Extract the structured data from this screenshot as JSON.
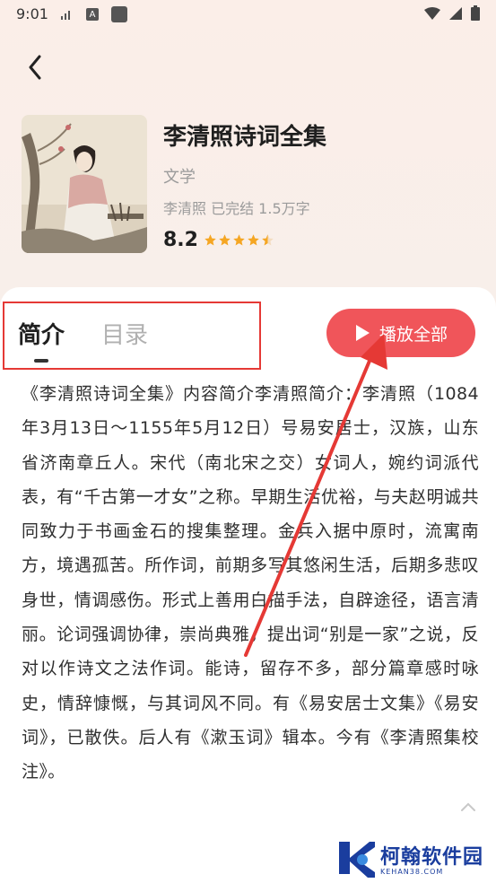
{
  "status_bar": {
    "time": "9:01"
  },
  "book": {
    "title": "李清照诗词全集",
    "genre": "文学",
    "meta": "李清照 已完结 1.5万字",
    "rating": "8.2",
    "stars": 4.5
  },
  "tabs": [
    {
      "label": "简介",
      "active": true
    },
    {
      "label": "目录",
      "active": false
    }
  ],
  "play_all_label": "播放全部",
  "description": "《李清照诗词全集》内容简介李清照简介：李清照（1084年3月13日～1155年5月12日）号易安居士，汉族，山东省济南章丘人。宋代（南北宋之交）女词人，婉约词派代表，有“千古第一才女”之称。早期生活优裕，与夫赵明诚共同致力于书画金石的搜集整理。金兵入据中原时，流寓南方，境遇孤苦。所作词，前期多写其悠闲生活，后期多悲叹身世，情调感伤。形式上善用白描手法，自辟途径，语言清丽。论词强调协律，崇尚典雅，提出词“别是一家”之说，反对以作诗文之法作词。能诗，留存不多，部分篇章感时咏史，情辞慷慨，与其词风不同。有《易安居士文集》《易安词》，已散佚。后人有《漱玉词》辑本。今有《李清照集校注》。",
  "watermark": {
    "name": "柯翰软件园",
    "domain": "KEHAN38.COM"
  },
  "colors": {
    "accent": "#f0555a",
    "highlight_box": "#e53935",
    "star": "#f5a623"
  }
}
